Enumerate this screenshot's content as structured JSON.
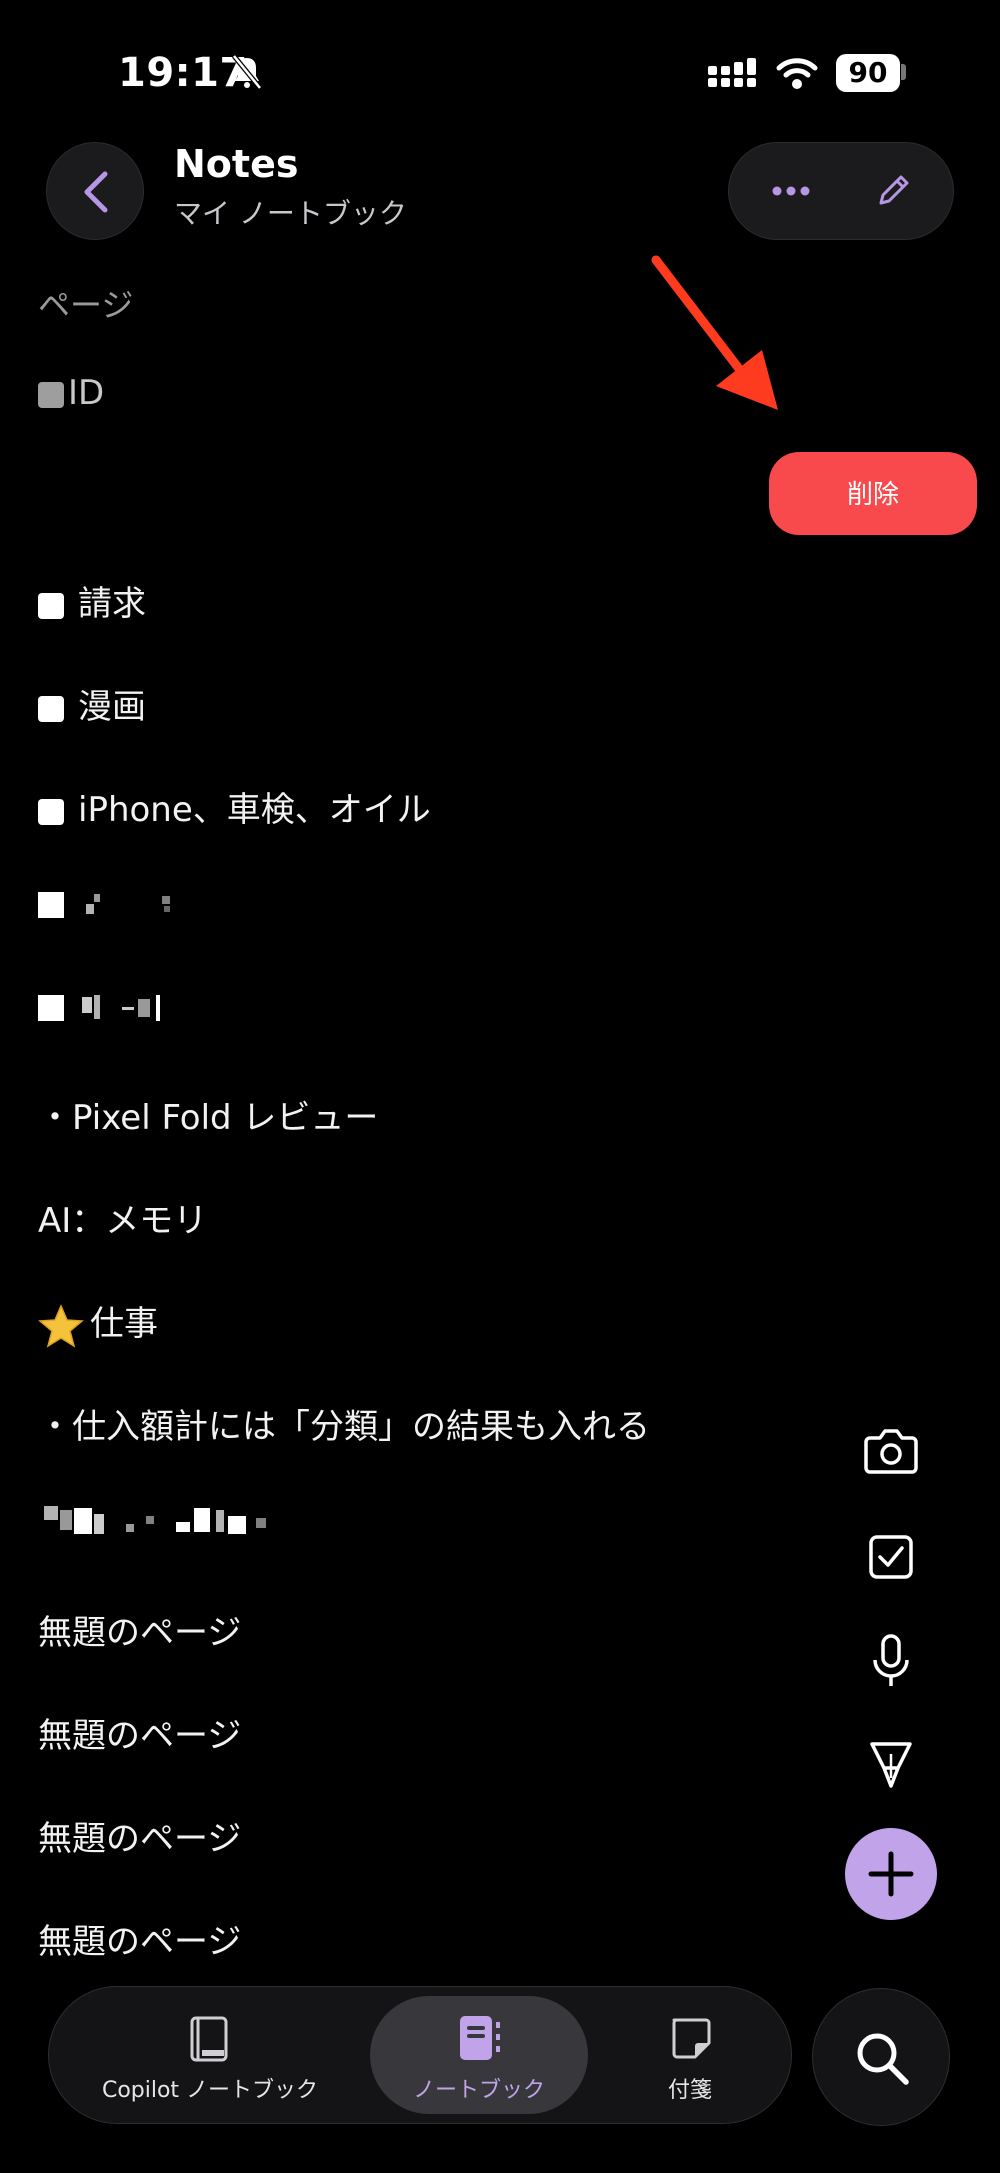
{
  "status_bar": {
    "time": "19:17",
    "battery": "90"
  },
  "header": {
    "title": "Notes",
    "subtitle": "マイ ノートブック"
  },
  "section_label": "ページ",
  "delete_label": "削除",
  "rows": [
    {
      "text": "ID"
    },
    {
      "text": "請求"
    },
    {
      "text": "漫画"
    },
    {
      "text": "iPhone、車検、オイル"
    },
    {
      "text": "・Pixel Fold レビュー"
    },
    {
      "text": "AI：メモリ"
    },
    {
      "text": "仕事"
    },
    {
      "text": "・仕入額計には「分類」の結果も入れる"
    },
    {
      "text": "無題のページ"
    },
    {
      "text": "無題のページ"
    },
    {
      "text": "無題のページ"
    },
    {
      "text": "無題のページ"
    }
  ],
  "tabs": [
    {
      "label": "Copilot ノートブック"
    },
    {
      "label": "ノートブック"
    },
    {
      "label": "付箋"
    }
  ],
  "colors": {
    "accent": "#c1a3ea",
    "delete": "#f84a4c",
    "arrow": "#ff3b1f"
  }
}
